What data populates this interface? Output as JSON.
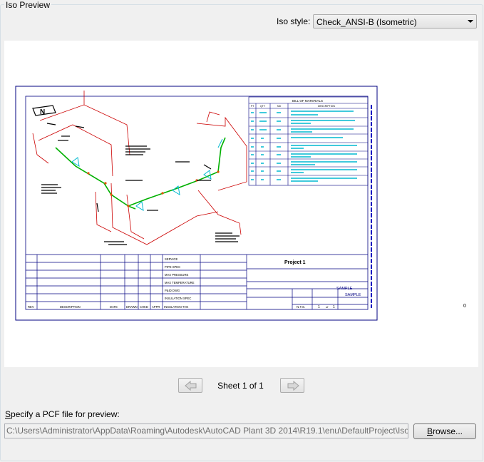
{
  "group": {
    "title": "Iso Preview"
  },
  "iso_style": {
    "label": "Iso style:",
    "value": "Check_ANSI-B (Isometric)"
  },
  "drawing": {
    "bom_title": "BILL OF MATERIALS",
    "bom_headers": [
      "PT",
      "QTY",
      "ND",
      "DESCRIPTION"
    ],
    "project": "Project 1",
    "sample1": "SAMPLE",
    "sample2": "SAMPLE",
    "scale": "N.T.S.",
    "sheet_no": "1",
    "sheet_of": "of",
    "sheet_total": "1",
    "right_margin_value": "0",
    "title_rows": [
      "SERVICE",
      "PIPE SPEC",
      "MAX PRESSURE",
      "MAX TEMPERATURE",
      "P&ID DWG",
      "INSULATION SPEC"
    ],
    "rev_headers": [
      "REV",
      "DESCRIPTION",
      "DATE",
      "DRAWN",
      "CHKD",
      "APPR",
      "INSULATION THK"
    ],
    "north": "N"
  },
  "pager": {
    "text": "Sheet 1 of 1",
    "prev_icon": "arrow-left-icon",
    "next_icon": "arrow-right-icon"
  },
  "pcf": {
    "label_mnemonic": "S",
    "label_rest": "pecify a PCF file for preview:",
    "path": "C:\\Users\\Administrator\\AppData\\Roaming\\Autodesk\\AutoCAD Plant 3D 2014\\R19.1\\enu\\DefaultProject\\Isometric\\Li",
    "browse_mnemonic": "B",
    "browse_rest": "rowse..."
  }
}
